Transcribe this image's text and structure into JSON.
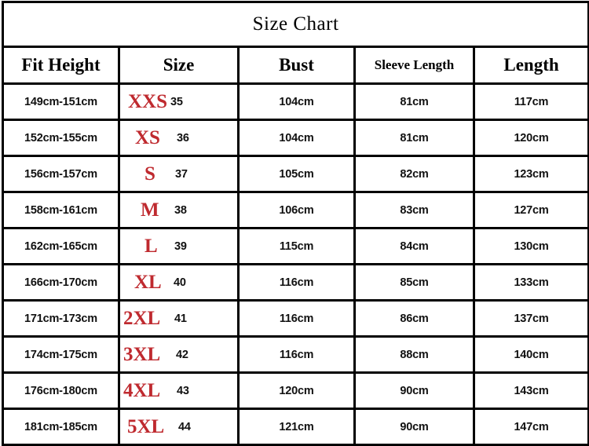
{
  "title": "Size Chart",
  "accent_color": "#bf2a2f",
  "text_color": "#111111",
  "border_color": "#000000",
  "background_color": "#ffffff",
  "columns": [
    {
      "key": "fit_height",
      "label": "Fit Height"
    },
    {
      "key": "size",
      "label": "Size"
    },
    {
      "key": "bust",
      "label": "Bust"
    },
    {
      "key": "sleeve_length",
      "label": "Sleeve Length"
    },
    {
      "key": "length",
      "label": "Length"
    }
  ],
  "rows": [
    {
      "fit_height": "149cm-151cm",
      "size_label": "XXS",
      "size_number": "35",
      "bust": "104cm",
      "sleeve_length": "81cm",
      "length": "117cm"
    },
    {
      "fit_height": "152cm-155cm",
      "size_label": "XS",
      "size_number": "36",
      "bust": "104cm",
      "sleeve_length": "81cm",
      "length": "120cm"
    },
    {
      "fit_height": "156cm-157cm",
      "size_label": "S",
      "size_number": "37",
      "bust": "105cm",
      "sleeve_length": "82cm",
      "length": "123cm"
    },
    {
      "fit_height": "158cm-161cm",
      "size_label": "M",
      "size_number": "38",
      "bust": "106cm",
      "sleeve_length": "83cm",
      "length": "127cm"
    },
    {
      "fit_height": "162cm-165cm",
      "size_label": "L",
      "size_number": "39",
      "bust": "115cm",
      "sleeve_length": "84cm",
      "length": "130cm"
    },
    {
      "fit_height": "166cm-170cm",
      "size_label": "XL",
      "size_number": "40",
      "bust": "116cm",
      "sleeve_length": "85cm",
      "length": "133cm"
    },
    {
      "fit_height": "171cm-173cm",
      "size_label": "2XL",
      "size_number": "41",
      "bust": "116cm",
      "sleeve_length": "86cm",
      "length": "137cm"
    },
    {
      "fit_height": "174cm-175cm",
      "size_label": "3XL",
      "size_number": "42",
      "bust": "116cm",
      "sleeve_length": "88cm",
      "length": "140cm"
    },
    {
      "fit_height": "176cm-180cm",
      "size_label": "4XL",
      "size_number": "43",
      "bust": "120cm",
      "sleeve_length": "90cm",
      "length": "143cm"
    },
    {
      "fit_height": "181cm-185cm",
      "size_label": "5XL",
      "size_number": "44",
      "bust": "121cm",
      "sleeve_length": "90cm",
      "length": "147cm"
    }
  ]
}
